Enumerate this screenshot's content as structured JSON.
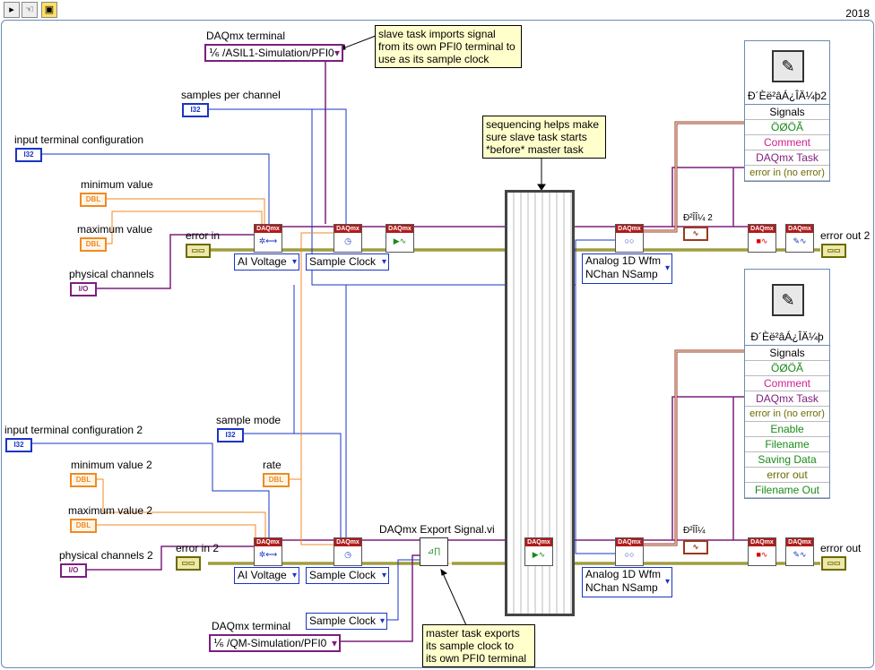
{
  "toolbar": {
    "year": "2018"
  },
  "labels": {
    "daqmx_terminal": "DAQmx terminal",
    "samples_per_channel": "samples per channel",
    "input_terminal_configuration": "input terminal configuration",
    "minimum_value": "minimum value",
    "maximum_value": "maximum value",
    "error_in": "error in",
    "physical_channels": "physical channels",
    "sample_mode": "sample mode",
    "input_terminal_configuration_2": "input terminal configuration 2",
    "rate": "rate",
    "minimum_value_2": "minimum value 2",
    "maximum_value_2": "maximum value 2",
    "error_in_2": "error in 2",
    "physical_channels_2": "physical channels 2",
    "daqmx_export_signal": "DAQmx Export Signal.vi",
    "daqmx_terminal_2": "DAQmx terminal",
    "error_out_2": "error out 2",
    "error_out": "error out"
  },
  "terminals": {
    "i32": "I32",
    "dbl": "DBL",
    "io": "I/O",
    "err": "▭▭"
  },
  "selectors": {
    "ai_voltage": "AI Voltage",
    "sample_clock": "Sample Clock",
    "analog_wfm_line1": "Analog 1D Wfm",
    "analog_wfm_line2": "NChan NSamp",
    "terminal_top": "/ASIL1-Simulation/PFI0",
    "terminal_bottom": "/QM-Simulation/PFI0"
  },
  "notes": {
    "slave": [
      "slave task imports signal",
      "from its own PFI0 terminal to",
      "use as its sample clock"
    ],
    "sequencing": [
      "sequencing helps make",
      "sure slave task starts",
      "*before* master task"
    ],
    "master": [
      "master task exports",
      "its sample clock to",
      "its own PFI0 terminal"
    ]
  },
  "clusters": {
    "top": {
      "name": "Ð´Èë²âÁ¿ÎÄ¼þ2",
      "rows": [
        "Signals",
        "ÖØÖÃ",
        "Comment",
        "DAQmx Task",
        "error in (no error)"
      ]
    },
    "bottom": {
      "name": "Ð´Èë²âÁ¿ÎÄ¼þ",
      "rows": [
        "Signals",
        "ÖØÖÃ",
        "Comment",
        "DAQmx Task",
        "error in (no error)",
        "Enable",
        "Filename",
        "Saving Data",
        "error out",
        "Filename Out"
      ]
    }
  },
  "small_labels": {
    "top": "Ð²ÎÎ¼ 2",
    "bottom": "Ð²ÎÎ¼"
  },
  "daqmx": "DAQmx",
  "colors": {
    "wire_blue": "#1a34c4",
    "wire_orange": "#f08a24",
    "wire_purple": "#7d1e7d",
    "wire_error": "#6b6b00",
    "wire_waveform": "#9b3a1a"
  }
}
